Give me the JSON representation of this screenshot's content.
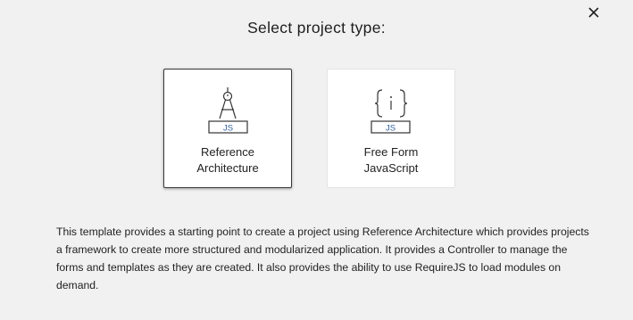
{
  "dialog": {
    "title": "Select project type:",
    "close_label": "Close"
  },
  "cards": [
    {
      "id": "reference-architecture",
      "line1": "Reference",
      "line2": "Architecture",
      "badge": "JS",
      "icon": "compass-icon",
      "selected": true
    },
    {
      "id": "free-form-javascript",
      "line1": "Free Form",
      "line2": "JavaScript",
      "badge": "JS",
      "icon": "braces-info-icon",
      "selected": false
    }
  ],
  "description": "This template provides a starting point to create a project using Reference Architecture which provides projects a framework to create more structured and modularized application. It provides a Controller to manage the forms and templates as they are created. It also provides the ability to use RequireJS to load modules on demand.",
  "colors": {
    "background": "#f1f1f1",
    "card_background": "#ffffff",
    "selected_border": "#3a3a3a",
    "icon_stroke": "#333333",
    "badge_text": "#2f5f9e"
  }
}
